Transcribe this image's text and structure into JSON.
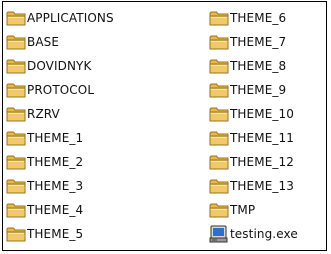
{
  "colors": {
    "folder_body": "#f2c96a",
    "folder_tab": "#e8b54a",
    "folder_outline": "#9a7420",
    "exe_screen": "#2f6fc9"
  },
  "left_column": [
    {
      "label": "APPLICATIONS",
      "icon": "folder-icon"
    },
    {
      "label": "BASE",
      "icon": "folder-icon"
    },
    {
      "label": "DOVIDNYK",
      "icon": "folder-icon"
    },
    {
      "label": "PROTOCOL",
      "icon": "folder-icon"
    },
    {
      "label": "RZRV",
      "icon": "folder-icon"
    },
    {
      "label": "THEME_1",
      "icon": "folder-icon"
    },
    {
      "label": "THEME_2",
      "icon": "folder-icon"
    },
    {
      "label": "THEME_3",
      "icon": "folder-icon"
    },
    {
      "label": "THEME_4",
      "icon": "folder-icon"
    },
    {
      "label": "THEME_5",
      "icon": "folder-icon"
    }
  ],
  "right_column": [
    {
      "label": "THEME_6",
      "icon": "folder-icon"
    },
    {
      "label": "THEME_7",
      "icon": "folder-icon"
    },
    {
      "label": "THEME_8",
      "icon": "folder-icon"
    },
    {
      "label": "THEME_9",
      "icon": "folder-icon"
    },
    {
      "label": "THEME_10",
      "icon": "folder-icon"
    },
    {
      "label": "THEME_11",
      "icon": "folder-icon"
    },
    {
      "label": "THEME_12",
      "icon": "folder-icon"
    },
    {
      "label": "THEME_13",
      "icon": "folder-icon"
    },
    {
      "label": "TMP",
      "icon": "folder-icon"
    },
    {
      "label": "testing.exe",
      "icon": "executable-icon"
    }
  ]
}
